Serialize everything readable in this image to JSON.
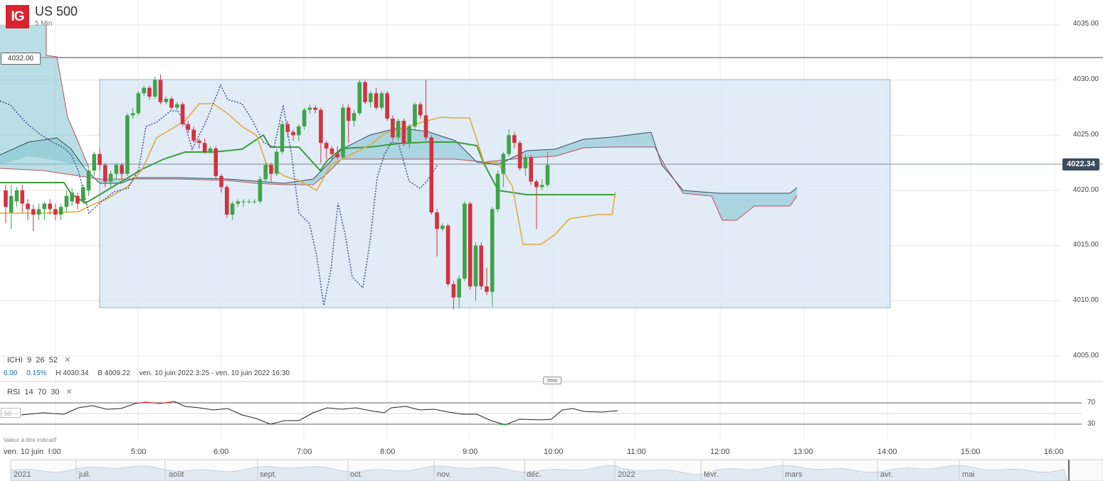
{
  "header": {
    "logo": "IG",
    "instrument": "US 500",
    "timeframe": "5 Min"
  },
  "horizontal_line_label": "4032.00",
  "current_price": "4022.34",
  "y_axis_labels": [
    "4035.00",
    "4030.00",
    "4025.00",
    "4020.00",
    "4015.00",
    "4010.00",
    "4005.00"
  ],
  "indicator_ichi": {
    "name": "ICHI",
    "p1": "9",
    "p2": "26",
    "p3": "52"
  },
  "stats": {
    "change": "6.00",
    "change_pct": "0.15%",
    "high": "H 4030.34",
    "low": "B 4009.22",
    "range": "ven. 10 juin 2022 3:25 - ven. 10 juin 2022 16:30"
  },
  "indicator_rsi": {
    "name": "RSI",
    "p1": "14",
    "p2": "70",
    "p3": "30",
    "mid": "50",
    "upper": "70",
    "lower": "30"
  },
  "footnote": "Valeur à titre indicatif",
  "x_axis_labels": [
    "ven. 10 juin",
    "l:00",
    "5:00",
    "6:00",
    "7:00",
    "8:00",
    "9:00",
    "10:00",
    "11:00",
    "12:00",
    "13:00",
    "14:00",
    "15:00",
    "16:00"
  ],
  "navigator_labels": [
    "2021",
    "juil.",
    "août",
    "sept.",
    "oct.",
    "nov.",
    "déc.",
    "2022",
    "févr.",
    "mars",
    "avr.",
    "mai"
  ],
  "colors": {
    "up": "#3ea34a",
    "down": "#d2323f",
    "tenkan": "#e3a93b",
    "kijun": "#3e9b3e",
    "chikou": "#4a5a8a",
    "cloud": "#7fc2d0",
    "selection": "#dce9f6"
  },
  "chart_data": {
    "type": "candlestick",
    "y_unit": "price",
    "ylim": [
      4003,
      4036.5
    ],
    "x_ticks": [
      "5:00",
      "6:00",
      "7:00",
      "8:00",
      "9:00",
      "10:00",
      "11:00",
      "12:00",
      "13:00",
      "14:00",
      "15:00",
      "16:00"
    ],
    "candles": [
      [
        4020.0,
        4018.5,
        4017.0,
        4020.5
      ],
      [
        4018.0,
        4019.5,
        4016.5,
        4020.5
      ],
      [
        4019.0,
        4020.0,
        4018.5,
        4020.3
      ],
      [
        4020.0,
        4018.8,
        4018.0,
        4020.5
      ],
      [
        4018.8,
        4018.3,
        4017.3,
        4019.2
      ],
      [
        4018.3,
        4017.8,
        4016.3,
        4018.7
      ],
      [
        4017.8,
        4018.3,
        4017.3,
        4018.8
      ],
      [
        4018.3,
        4018.8,
        4017.3,
        4019.0
      ],
      [
        4018.8,
        4018.3,
        4017.8,
        4019.2
      ],
      [
        4018.3,
        4017.8,
        4017.3,
        4018.8
      ],
      [
        4017.8,
        4018.5,
        4017.3,
        4018.8
      ],
      [
        4018.5,
        4019.5,
        4018.0,
        4020.0
      ],
      [
        4019.0,
        4019.8,
        4018.6,
        4020.2
      ],
      [
        4019.5,
        4018.8,
        4018.3,
        4019.8
      ],
      [
        4019.0,
        4020.3,
        4018.8,
        4020.5
      ],
      [
        4020.0,
        4021.8,
        4019.5,
        4022.0
      ],
      [
        4021.8,
        4023.3,
        4021.3,
        4023.5
      ],
      [
        4023.3,
        4022.3,
        4021.8,
        4023.8
      ],
      [
        4022.3,
        4020.8,
        4020.3,
        4022.5
      ],
      [
        4020.8,
        4021.5,
        4020.3,
        4021.8
      ],
      [
        4021.5,
        4022.3,
        4021.0,
        4022.5
      ],
      [
        4022.3,
        4021.5,
        4021.0,
        4022.5
      ],
      [
        4021.5,
        4026.8,
        4021.3,
        4027.0
      ],
      [
        4026.8,
        4027.0,
        4026.5,
        4027.5
      ],
      [
        4027.0,
        4028.8,
        4026.8,
        4029.0
      ],
      [
        4028.8,
        4029.3,
        4028.5,
        4029.5
      ],
      [
        4029.3,
        4028.5,
        4028.2,
        4029.5
      ],
      [
        4028.5,
        4030.0,
        4028.3,
        4030.3
      ],
      [
        4030.0,
        4028.0,
        4027.8,
        4030.5
      ],
      [
        4028.0,
        4028.3,
        4027.8,
        4028.5
      ],
      [
        4028.3,
        4027.5,
        4027.3,
        4028.5
      ],
      [
        4027.5,
        4027.8,
        4027.3,
        4028.0
      ],
      [
        4027.8,
        4026.0,
        4025.8,
        4028.0
      ],
      [
        4026.0,
        4025.5,
        4025.2,
        4026.3
      ],
      [
        4025.5,
        4024.5,
        4024.3,
        4025.8
      ],
      [
        4024.5,
        4024.3,
        4023.8,
        4024.7
      ],
      [
        4024.3,
        4023.5,
        4023.3,
        4024.7
      ],
      [
        4023.5,
        4023.8,
        4023.3,
        4024.0
      ],
      [
        4023.8,
        4021.3,
        4021.0,
        4024.0
      ],
      [
        4021.3,
        4020.3,
        4019.8,
        4021.5
      ],
      [
        4020.3,
        4017.8,
        4017.5,
        4020.5
      ],
      [
        4017.8,
        4018.8,
        4017.3,
        4019.0
      ],
      [
        4018.8,
        4019.0,
        4018.5,
        4019.2
      ],
      [
        4019.0,
        4019.0,
        4018.5,
        4019.2
      ],
      [
        4019.0,
        4019.0,
        4018.8,
        4019.2
      ],
      [
        4019.0,
        4019.0,
        4018.8,
        4019.2
      ],
      [
        4019.0,
        4021.0,
        4018.8,
        4021.3
      ],
      [
        4021.0,
        4022.3,
        4020.8,
        4022.5
      ],
      [
        4022.3,
        4021.5,
        4020.8,
        4022.5
      ],
      [
        4021.5,
        4023.5,
        4021.3,
        4023.8
      ],
      [
        4023.5,
        4026.0,
        4023.3,
        4026.3
      ],
      [
        4026.0,
        4025.3,
        4024.8,
        4026.3
      ],
      [
        4025.3,
        4025.0,
        4024.5,
        4025.5
      ],
      [
        4025.0,
        4025.8,
        4024.5,
        4026.0
      ],
      [
        4025.8,
        4027.3,
        4025.5,
        4027.5
      ],
      [
        4027.3,
        4027.5,
        4027.0,
        4027.8
      ],
      [
        4027.5,
        4027.3,
        4027.0,
        4027.7
      ],
      [
        4027.3,
        4024.3,
        4022.5,
        4027.5
      ],
      [
        4024.3,
        4023.8,
        4022.8,
        4024.5
      ],
      [
        4023.8,
        4023.3,
        4022.8,
        4024.0
      ],
      [
        4023.3,
        4023.0,
        4022.8,
        4024.0
      ],
      [
        4023.0,
        4027.5,
        4022.8,
        4027.8
      ],
      [
        4027.5,
        4026.3,
        4024.3,
        4027.8
      ],
      [
        4026.3,
        4027.0,
        4025.8,
        4027.3
      ],
      [
        4027.0,
        4029.8,
        4026.8,
        4030.0
      ],
      [
        4029.8,
        4028.0,
        4027.8,
        4030.0
      ],
      [
        4028.0,
        4028.8,
        4027.5,
        4029.0
      ],
      [
        4028.8,
        4027.5,
        4027.3,
        4029.3
      ],
      [
        4027.5,
        4028.8,
        4027.3,
        4029.0
      ],
      [
        4028.8,
        4026.5,
        4026.3,
        4029.0
      ],
      [
        4026.5,
        4024.8,
        4024.5,
        4026.8
      ],
      [
        4024.8,
        4026.3,
        4024.5,
        4026.5
      ],
      [
        4026.3,
        4024.3,
        4024.0,
        4026.5
      ],
      [
        4024.3,
        4025.8,
        4023.8,
        4026.0
      ],
      [
        4025.8,
        4027.8,
        4025.5,
        4028.0
      ],
      [
        4027.8,
        4026.8,
        4026.5,
        4028.0
      ],
      [
        4026.8,
        4024.8,
        4024.5,
        4030.0
      ],
      [
        4024.8,
        4018.0,
        4017.8,
        4025.0
      ],
      [
        4018.0,
        4016.5,
        4014.0,
        4018.3
      ],
      [
        4016.5,
        4016.8,
        4016.3,
        4017.0
      ],
      [
        4016.8,
        4011.5,
        4011.3,
        4017.0
      ],
      [
        4011.5,
        4010.3,
        4009.2,
        4011.8
      ],
      [
        4010.3,
        4012.0,
        4009.3,
        4012.3
      ],
      [
        4012.0,
        4018.8,
        4011.8,
        4019.0
      ],
      [
        4018.8,
        4011.3,
        4011.0,
        4019.0
      ],
      [
        4011.3,
        4015.0,
        4010.0,
        4015.3
      ],
      [
        4015.0,
        4011.3,
        4011.0,
        4015.3
      ],
      [
        4011.3,
        4010.8,
        4010.5,
        4013.0
      ],
      [
        4010.8,
        4018.3,
        4009.5,
        4018.5
      ],
      [
        4018.3,
        4021.5,
        4018.0,
        4021.8
      ],
      [
        4021.5,
        4023.3,
        4020.3,
        4023.5
      ],
      [
        4023.3,
        4025.0,
        4023.0,
        4025.5
      ],
      [
        4025.0,
        4024.3,
        4023.8,
        4025.3
      ],
      [
        4024.3,
        4022.0,
        4021.8,
        4024.5
      ],
      [
        4022.0,
        4023.0,
        4021.3,
        4023.3
      ],
      [
        4023.0,
        4020.8,
        4020.5,
        4023.2
      ],
      [
        4020.8,
        4020.3,
        4016.5,
        4021.0
      ],
      [
        4020.3,
        4020.5,
        4020.0,
        4021.0
      ],
      [
        4020.5,
        4022.3,
        4020.3,
        4023.5
      ]
    ]
  }
}
